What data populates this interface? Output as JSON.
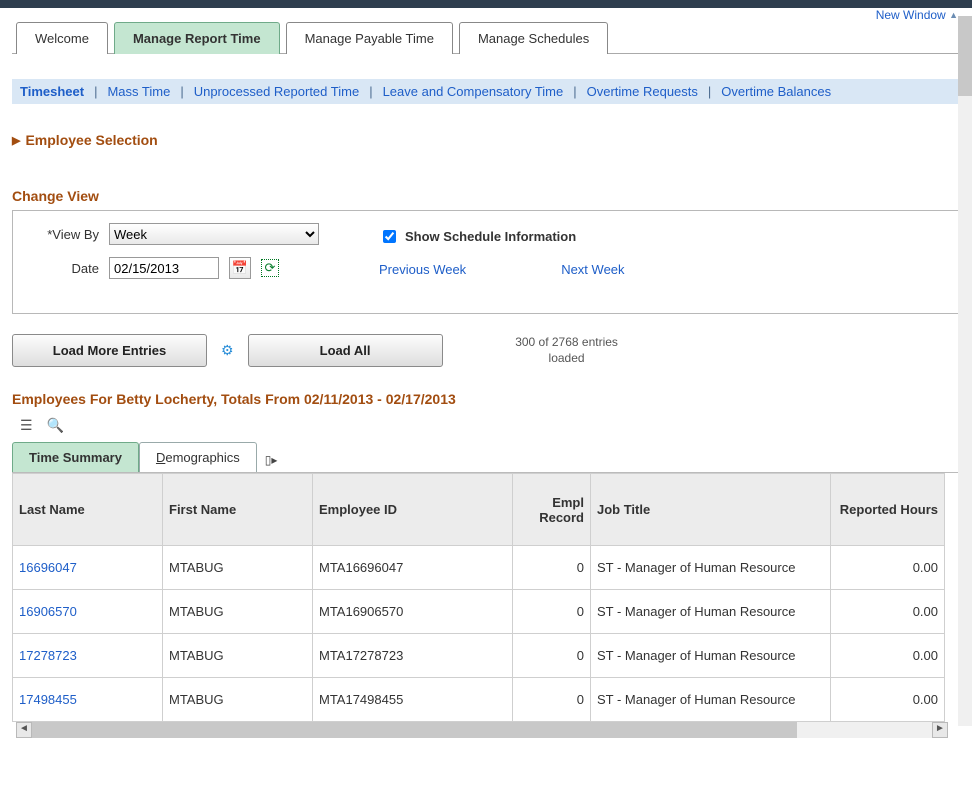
{
  "topLinks": {
    "newWindow": "New Window"
  },
  "tabs": {
    "welcome": "Welcome",
    "manageReportTime": "Manage Report Time",
    "managePayableTime": "Manage Payable Time",
    "manageSchedules": "Manage Schedules"
  },
  "subnav": {
    "timesheet": "Timesheet",
    "massTime": "Mass Time",
    "unprocessed": "Unprocessed Reported Time",
    "leave": "Leave and Compensatory Time",
    "overtimeReq": "Overtime Requests",
    "overtimeBal": "Overtime Balances"
  },
  "employeeSelection": {
    "title": "Employee Selection"
  },
  "changeView": {
    "title": "Change View",
    "viewByLabel": "*View By",
    "viewByValue": "Week",
    "dateLabel": "Date",
    "dateValue": "02/15/2013",
    "showScheduleLabel": "Show Schedule Information",
    "showScheduleChecked": true,
    "prevWeek": "Previous Week",
    "nextWeek": "Next Week"
  },
  "loadButtons": {
    "loadMore": "Load More Entries",
    "loadAll": "Load All",
    "loadedText": "300 of 2768 entries loaded"
  },
  "employeesHeading": "Employees For Betty Locherty, Totals From 02/11/2013 - 02/17/2013",
  "gridTabs": {
    "timeSummary": "Time Summary",
    "demographics": "Demographics"
  },
  "gridColumns": {
    "lastName": "Last Name",
    "firstName": "First Name",
    "employeeId": "Employee ID",
    "emplRecord": "Empl Record",
    "jobTitle": "Job Title",
    "reportedHours": "Reported Hours"
  },
  "rows": [
    {
      "lastName": "16696047",
      "firstName": "MTABUG",
      "employeeId": "MTA16696047",
      "emplRecord": "0",
      "jobTitle": "ST - Manager of Human Resource",
      "reportedHours": "0.00"
    },
    {
      "lastName": "16906570",
      "firstName": "MTABUG",
      "employeeId": "MTA16906570",
      "emplRecord": "0",
      "jobTitle": "ST - Manager of Human Resource",
      "reportedHours": "0.00"
    },
    {
      "lastName": "17278723",
      "firstName": "MTABUG",
      "employeeId": "MTA17278723",
      "emplRecord": "0",
      "jobTitle": "ST - Manager of Human Resource",
      "reportedHours": "0.00"
    },
    {
      "lastName": "17498455",
      "firstName": "MTABUG",
      "employeeId": "MTA17498455",
      "emplRecord": "0",
      "jobTitle": "ST - Manager of Human Resource",
      "reportedHours": "0.00"
    }
  ]
}
